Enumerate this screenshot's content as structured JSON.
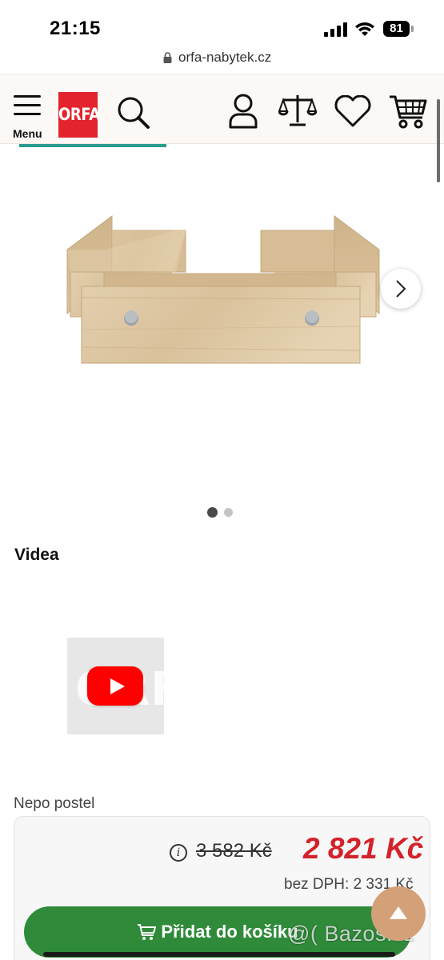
{
  "status_bar": {
    "time": "21:15",
    "battery": "81"
  },
  "browser": {
    "url": "orfa-nabytek.cz"
  },
  "header": {
    "menu_label": "Menu",
    "logo_text": "ORFA",
    "icons": [
      "menu-icon",
      "search-icon",
      "user-icon",
      "compare-scale-icon",
      "heart-icon",
      "cart-icon"
    ]
  },
  "gallery": {
    "active_slide": 1,
    "slide_count": 2
  },
  "videos": {
    "heading": "Videa",
    "thumb_logo": "ORFA"
  },
  "product": {
    "name": "Nepo postel",
    "old_price": "3 582 Kč",
    "price": "2 821 Kč",
    "price_without_vat": "bez DPH: 2 331 Kč",
    "add_to_cart": "Přidat do košíku"
  },
  "watermark": "@( Bazos.cz",
  "colors": {
    "brand_red": "#e3232d",
    "price_red": "#d3222a",
    "cart_green": "#2f8b3a",
    "accent_teal": "#2a9d8f",
    "scroll_top": "#d4a078"
  }
}
